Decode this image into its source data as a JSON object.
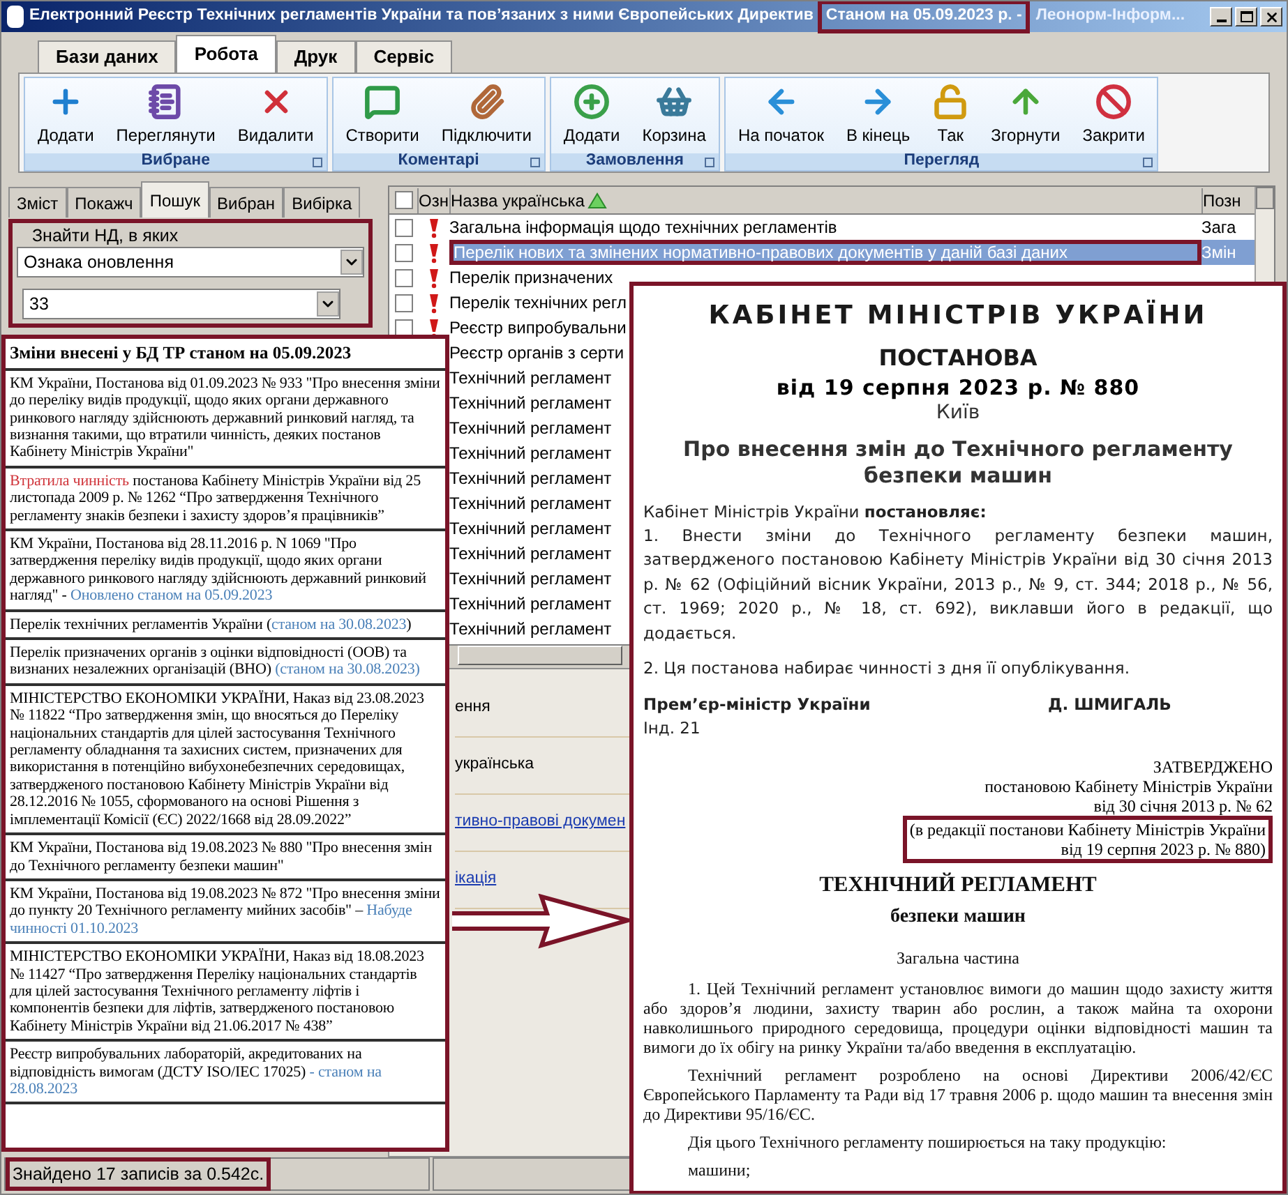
{
  "window": {
    "title": "Електронний Реєстр Технічних регламентів України та пов’язаних з ними Європейських Директив",
    "status": "Станом на 05.09.2023 р. -",
    "publisher": "Леонорм-Інформ..."
  },
  "menu_tabs": [
    {
      "label": "Бази даних",
      "selected": false
    },
    {
      "label": "Робота",
      "selected": true
    },
    {
      "label": "Друк",
      "selected": false
    },
    {
      "label": "Сервіс",
      "selected": false
    }
  ],
  "ribbon": [
    {
      "title": "Вибране",
      "buttons": [
        {
          "label": "Додати",
          "kind": "plus"
        },
        {
          "label": "Переглянути",
          "kind": "notepad"
        },
        {
          "label": "Видалити",
          "kind": "cross"
        }
      ]
    },
    {
      "title": "Коментарі",
      "buttons": [
        {
          "label": "Створити",
          "kind": "comment"
        },
        {
          "label": "Підключити",
          "kind": "clip"
        }
      ]
    },
    {
      "title": "Замовлення",
      "buttons": [
        {
          "label": "Додати",
          "kind": "plus-circle"
        },
        {
          "label": "Корзина",
          "kind": "basket"
        }
      ]
    },
    {
      "title": "Перегляд",
      "buttons": [
        {
          "label": "На початок",
          "kind": "left"
        },
        {
          "label": "В кінець",
          "kind": "right"
        },
        {
          "label": "Так",
          "kind": "lock"
        },
        {
          "label": "Згорнути",
          "kind": "up"
        },
        {
          "label": "Закрити",
          "kind": "stop"
        }
      ]
    }
  ],
  "left_tabs": [
    {
      "label": "Зміст",
      "selected": false
    },
    {
      "label": "Покажч",
      "selected": false
    },
    {
      "label": "Пошук",
      "selected": true
    },
    {
      "label": "Вибран",
      "selected": false
    },
    {
      "label": "Вибірка",
      "selected": false
    }
  ],
  "search": {
    "label": "Знайти НД, в яких",
    "field": "Ознака оновлення",
    "value": "33"
  },
  "table": {
    "select_all": {
      "checked": false
    },
    "columns": [
      "Озн",
      "Назва українська",
      "Позн"
    ],
    "rows": [
      {
        "name": "Загальна інформація щодо технічних регламентів",
        "code": "Зага",
        "checked": false,
        "selected": false
      },
      {
        "name": "Перелік нових та змінених нормативно-правових документів у даній базі даних",
        "code": "Змін",
        "checked": false,
        "selected": true
      },
      {
        "name": "Перелік призначених",
        "checked": false,
        "selected": false
      },
      {
        "name": "Перелік технічних регл",
        "checked": false,
        "selected": false
      },
      {
        "name": "Реєстр випробувальни",
        "checked": false,
        "selected": false
      },
      {
        "name": "Реєстр органів з серти",
        "selected": false
      },
      {
        "name": "Технічний регламент",
        "selected": false
      },
      {
        "name": "Технічний регламент",
        "selected": false
      },
      {
        "name": "Технічний регламент",
        "selected": false
      },
      {
        "name": "Технічний регламент",
        "selected": false
      },
      {
        "name": "Технічний регламент",
        "selected": false
      },
      {
        "name": "Технічний регламент",
        "selected": false
      },
      {
        "name": "Технічний регламент",
        "selected": false
      },
      {
        "name": "Технічний регламент",
        "selected": false
      },
      {
        "name": "Технічний регламент",
        "selected": false
      },
      {
        "name": "Технічний регламент",
        "selected": false
      },
      {
        "name": "Технічний регламент",
        "selected": false
      }
    ]
  },
  "details": [
    {
      "kind": "text",
      "text": "ення"
    },
    {
      "kind": "text",
      "text": "українська"
    },
    {
      "kind": "link",
      "text": "тивно-правові докумен"
    },
    {
      "kind": "link",
      "text": "ікація"
    }
  ],
  "status_bar": {
    "text": "Знайдено 17 записів за 0.542с."
  },
  "changes_panel": {
    "title": "Зміни внесені у БД ТР станом на 05.09.2023",
    "items": [
      {
        "parts": [
          {
            "kind": "plain",
            "text": "КМ України, Постанова від 01.09.2023 № 933 \"Про внесення зміни до переліку видів продукції, щодо яких органи державного ринкового нагляду здійснюють державний ринковий нагляд, та визнання такими, що втратили чинність, деяких постанов Кабінету Міністрів України\""
          }
        ]
      },
      {
        "parts": [
          {
            "kind": "expired",
            "text": "Втратила чинність"
          },
          {
            "kind": "plain",
            "text": " постанова Кабінету Міністрів України від 25 листопада 2009 р. № 1262 “Про затвердження Технічного регламенту знаків безпеки і захисту здоров’я працівників”"
          }
        ]
      },
      {
        "parts": [
          {
            "kind": "plain",
            "text": "КМ України, Постанова від 28.11.2016 р. N 1069  \"Про затвердження переліку видів продукції, щодо яких органи державного ринкового нагляду здійснюють державний ринковий нагляд\" - "
          },
          {
            "kind": "status",
            "text": "Оновлено станом на 05.09.2023"
          }
        ]
      },
      {
        "parts": [
          {
            "kind": "plain",
            "text": "Перелік технічних регламентів України ("
          },
          {
            "kind": "status",
            "text": "станом на 30.08.2023"
          },
          {
            "kind": "plain",
            "text": ")"
          }
        ]
      },
      {
        "parts": [
          {
            "kind": "plain",
            "text": "Перелік призначених органів з оцінки відповідності (ООВ) та визнаних незалежних організацій (ВНО) "
          },
          {
            "kind": "status",
            "text": "(станом на 30.08.2023)"
          }
        ]
      },
      {
        "parts": [
          {
            "kind": "plain",
            "text": "МІНІСТЕРСТВО ЕКОНОМІКИ  УКРАЇНИ, Наказ від 23.08.2023 № 11822 “Про затвердження змін, що вносяться до Переліку національних стандартів для цілей застосування Технічного регламенту обладнання та захисних систем, призначених для використання в потенційно вибухонебезпечних середовищах, затвердженого постановою Кабінету Міністрів України від 28.12.2016 № 1055, сформованого на основі Рішення з імплементації Комісії (ЄС) 2022/1668 від 28.09.2022”"
          }
        ]
      },
      {
        "parts": [
          {
            "kind": "plain",
            "text": "КМ України, Постанова від 19.08.2023 № 880 \"Про внесення змін до Технічного регламенту безпеки машин\""
          }
        ]
      },
      {
        "parts": [
          {
            "kind": "plain",
            "text": "КМ України, Постанова від 19.08.2023 № 872 \"Про внесення зміни до пункту 20 Технічного регламенту мийних засобів\" – "
          },
          {
            "kind": "status",
            "text": "Набуде чинності 01.10.2023"
          }
        ]
      },
      {
        "parts": [
          {
            "kind": "plain",
            "text": "МІНІСТЕРСТВО ЕКОНОМІКИ  УКРАЇНИ, Наказ від 18.08.2023 № 11427 “Про затвердження Переліку національних стандартів для цілей застосування Технічного регламенту ліфтів і компонентів безпеки для ліфтів, затвердженого постановою Кабінету Міністрів України від 21.06.2017 № 438”"
          }
        ]
      },
      {
        "parts": [
          {
            "kind": "plain",
            "text": "Реєстр випробувальних лабораторій, акредитованих на відповідність вимогам (ДСТУ ISO/IEC 17025) "
          },
          {
            "kind": "status",
            "text": "- станом на 28.08.2023"
          }
        ]
      }
    ]
  },
  "document": {
    "org": "КАБІНЕТ МІНІСТРІВ УКРАЇНИ",
    "type": "ПОСТАНОВА",
    "date": "від 19 серпня 2023 р. № 880",
    "city": "Київ",
    "title": "Про внесення змін до Технічного регламенту безпеки машин",
    "preamble": "Кабінет Міністрів України **постановляє:**",
    "points": [
      "1. Внести зміни до Технічного регламенту безпеки машин, затвердженого постановою Кабінету Міністрів України від 30 січня 2013 р. № 62 (Офіційний вісник України, 2013 р., № 9, ст. 344; 2018 р., № 56, ст. 1969; 2020 р., № 18, ст. 692), виклавши його в редакції, що додається.",
      "2. Ця постанова набирає чинності з дня її опублікування."
    ],
    "signer_role": "Прем’єр-міністр України",
    "signer_name": "Д. ШМИГАЛЬ",
    "index": "Інд. 21",
    "approved": [
      "ЗАТВЕРДЖЕНО",
      "постановою Кабінету Міністрів  України",
      "від 30 січня 2013 р. № 62"
    ],
    "revision": [
      "(в редакції  постанови Кабінету Міністрів  України",
      "від 19 серпня  2023 р. № 880)"
    ],
    "reg_title": "ТЕХНІЧНИЙ РЕГЛАМЕНТ",
    "reg_subtitle": "безпеки машин",
    "section": "Загальна частина",
    "paragraphs": [
      "1. Цей Технічний регламент установлює вимоги до машин щодо захисту життя або здоров’я людини, захисту тварин або рослин, а також майна та охорони навколишнього природного середовища, процедури оцінки відповідності машин та вимоги до їх обігу на ринку України та/або введення в експлуатацію.",
      "Технічний регламент розроблено на основі Директиви 2006/42/ЄС Європейського Парламенту та Ради від 17 травня 2006 р. щодо машин та внесення змін до Директиви 95/16/ЄС.",
      "Дія цього Технічного регламенту поширюється  на таку продукцію:",
      "машини;"
    ]
  }
}
